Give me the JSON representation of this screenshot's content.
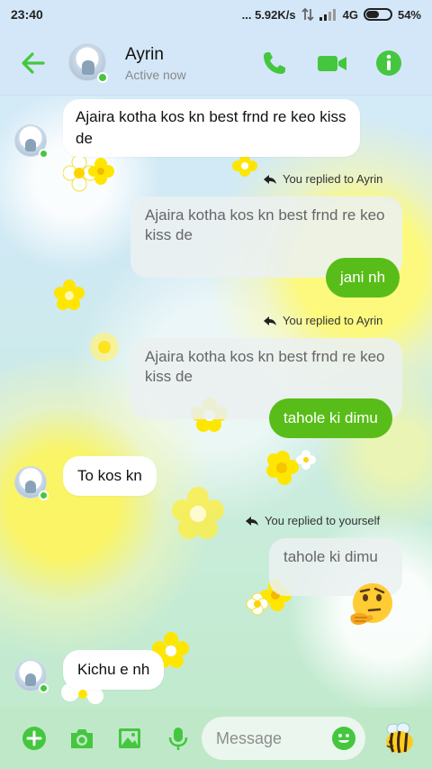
{
  "status_bar": {
    "time": "23:40",
    "net_speed": "... 5.92K/s",
    "network": "4G",
    "battery": "54%",
    "battery_level": 0.54
  },
  "header": {
    "contact_name": "Ayrin",
    "contact_status": "Active now",
    "icons": [
      "back-arrow-icon",
      "phone-icon",
      "video-camera-icon",
      "info-icon"
    ],
    "accent_color": "#44c73f"
  },
  "messages": [
    {
      "side": "in",
      "text": "Ajaira kotha kos kn best frnd re keo kiss de"
    },
    {
      "reply_label": "You replied to Ayrin",
      "quoted": "Ajaira kotha kos kn best frnd re keo kiss de",
      "side": "out",
      "text": "jani nh"
    },
    {
      "reply_label": "You replied to Ayrin",
      "quoted": "Ajaira kotha kos kn best frnd re keo kiss de",
      "side": "out",
      "text": "tahole ki dimu"
    },
    {
      "side": "in",
      "text": "To kos kn"
    },
    {
      "reply_label": "You replied to yourself",
      "quoted": "tahole ki dimu",
      "side": "out",
      "emoji": "thinking-face"
    },
    {
      "side": "in",
      "text": "Kichu e nh"
    }
  ],
  "composer": {
    "placeholder": "Message",
    "icons": [
      "plus-icon",
      "camera-icon",
      "image-icon",
      "microphone-icon",
      "emoji-icon",
      "bee-sticker-icon"
    ]
  },
  "colors": {
    "outgoing_bubble": "#58bd18",
    "incoming_bubble": "#ffffff",
    "header_bg": "#d4e7f8",
    "composer_bg": "#bfe8c8"
  }
}
